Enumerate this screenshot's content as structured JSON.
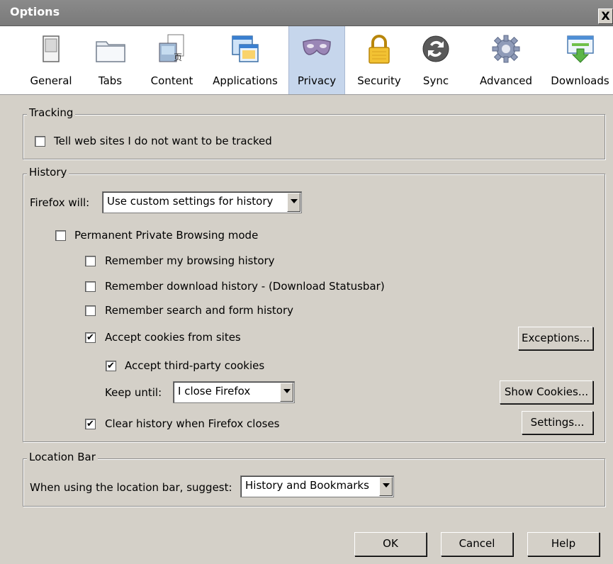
{
  "window": {
    "title": "Options",
    "close_glyph": "X"
  },
  "toolbar": {
    "panes": [
      {
        "label": "General",
        "icon": "general-switch-icon"
      },
      {
        "label": "Tabs",
        "icon": "tabs-folder-icon"
      },
      {
        "label": "Content",
        "icon": "content-icon"
      },
      {
        "label": "Applications",
        "icon": "applications-icon"
      },
      {
        "label": "Privacy",
        "icon": "privacy-mask-icon",
        "selected": true
      },
      {
        "label": "Security",
        "icon": "padlock-icon"
      },
      {
        "label": "Sync",
        "icon": "sync-icon"
      },
      {
        "label": "Advanced",
        "icon": "gear-icon"
      },
      {
        "label": "Downloads",
        "icon": "downloads-icon"
      }
    ]
  },
  "tracking": {
    "legend": "Tracking",
    "do_not_track_label": "Tell web sites I do not want to be tracked",
    "do_not_track_checked": false
  },
  "history": {
    "legend": "History",
    "firefox_will_label": "Firefox will:",
    "firefox_will_value": "Use custom settings for history",
    "private_browsing_label": "Permanent Private Browsing mode",
    "remember_browsing_label": "Remember my browsing history",
    "remember_download_label": "Remember download history - (Download Statusbar)",
    "remember_search_label": "Remember search and form history",
    "accept_cookies_label": "Accept cookies from sites",
    "accept_third_party_label": "Accept third-party cookies",
    "keep_until_label": "Keep until:",
    "keep_until_value": "I close Firefox",
    "clear_history_label": "Clear history when Firefox closes",
    "exceptions_button": "Exceptions...",
    "show_cookies_button": "Show Cookies...",
    "settings_button": "Settings...",
    "checks": {
      "private_browsing": false,
      "remember_browsing": false,
      "remember_download": false,
      "remember_search": false,
      "accept_cookies": true,
      "accept_third_party": true,
      "clear_history": true
    }
  },
  "location_bar": {
    "legend": "Location Bar",
    "suggest_label": "When using the location bar, suggest:",
    "suggest_value": "History and Bookmarks"
  },
  "buttons": {
    "ok": "OK",
    "cancel": "Cancel",
    "help": "Help"
  },
  "check_glyph": "✔"
}
